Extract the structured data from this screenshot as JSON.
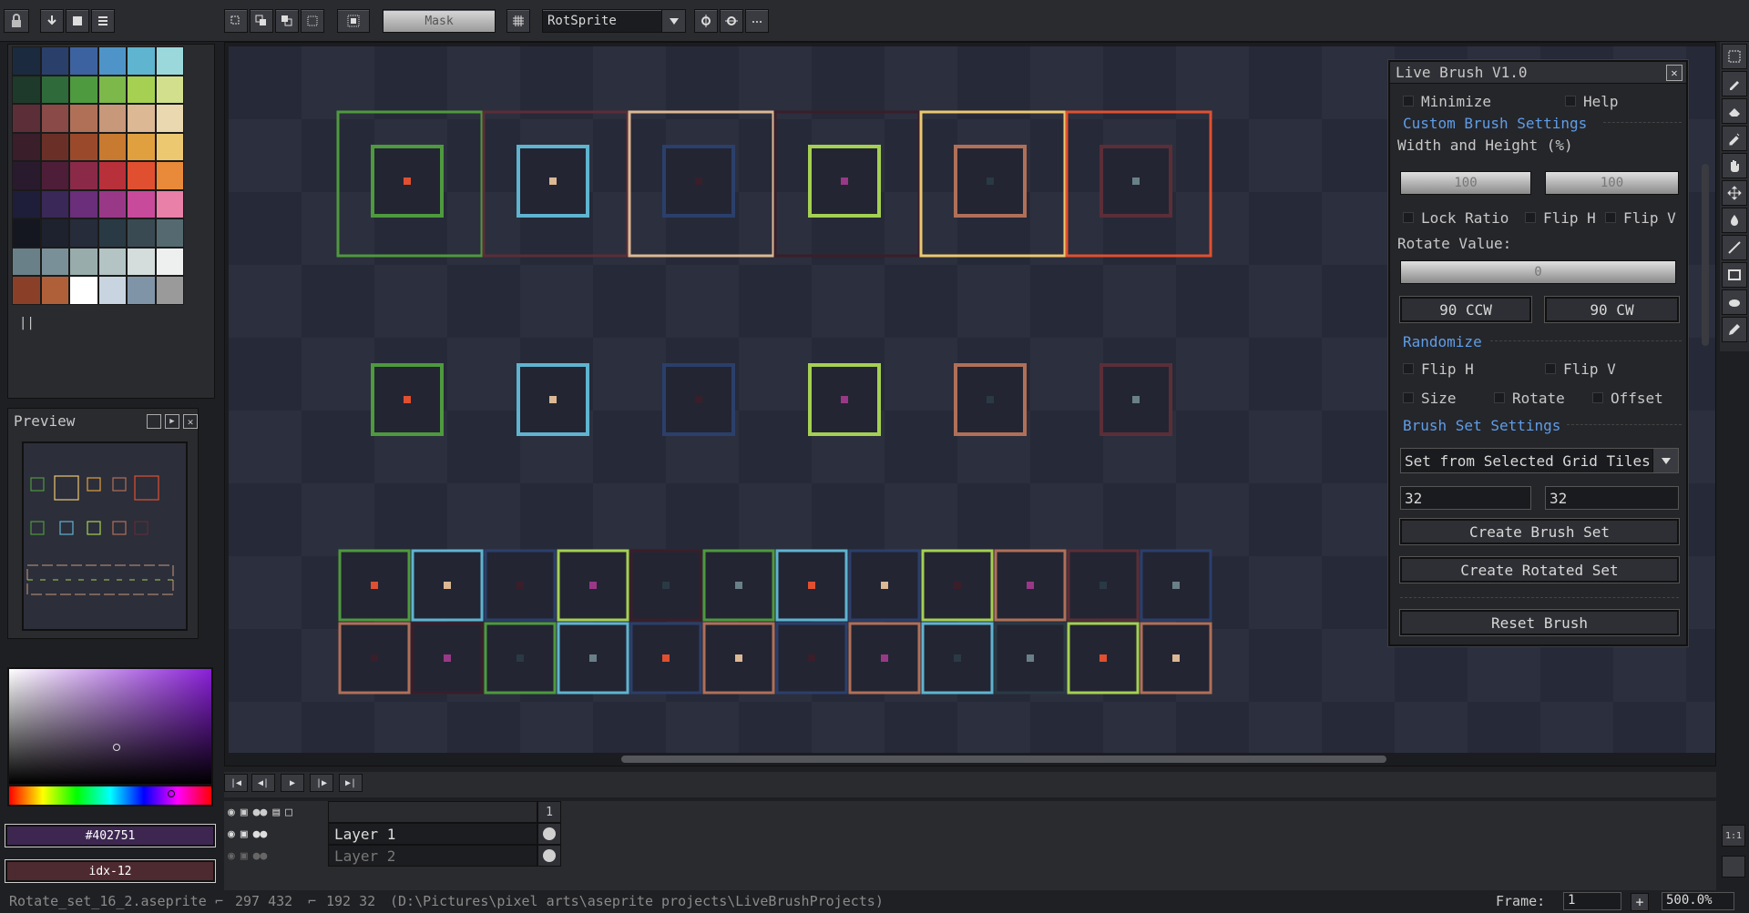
{
  "toolbar": {
    "mask_label": "Mask",
    "rotation_algorithm": "RotSprite"
  },
  "palette": {
    "colors": [
      "#1b2a3e",
      "#2b3f6b",
      "#3d62a0",
      "#4f94c8",
      "#5fb4d0",
      "#9bd8dc",
      "#1e3a2a",
      "#2f6a3a",
      "#4e9a3e",
      "#7db84a",
      "#a5d052",
      "#d2e08e",
      "#5b2e38",
      "#8a4a48",
      "#b07058",
      "#c8987a",
      "#dcb894",
      "#ead8b0",
      "#3a1e2a",
      "#6a3028",
      "#9a4a2a",
      "#c87a30",
      "#e0a040",
      "#ecc870",
      "#2a1a2e",
      "#4e1e38",
      "#8a2a48",
      "#b8303a",
      "#e05030",
      "#e88a3a",
      "#1e1e3a",
      "#3a2858",
      "#6a2e7a",
      "#9a3888",
      "#c84a9a",
      "#e880a8",
      "#141620",
      "#1e222e",
      "#262c3a",
      "#2a3a44",
      "#3a4a52",
      "#546a70",
      "#6a8088",
      "#7a9098",
      "#98acac",
      "#b4c4c4",
      "#d4dcdc",
      "#eef0f0",
      "#8a4028",
      "#b06038",
      "#ffffff",
      "#c8d4e0",
      "#8094a8",
      "#9a9a9a"
    ],
    "drag_handle": "||"
  },
  "preview": {
    "title": "Preview"
  },
  "color": {
    "hex": "#402751",
    "index": "idx-12",
    "accent": "#402751"
  },
  "dialog": {
    "title": "Live Brush V1.0",
    "minimize": "Minimize",
    "help": "Help",
    "custom_section": "Custom Brush Settings",
    "wh_label": "Width and Height (%)",
    "width": "100",
    "height": "100",
    "lock_ratio": "Lock Ratio",
    "flip_h": "Flip H",
    "flip_v": "Flip V",
    "rotate_label": "Rotate Value:",
    "rotate_value": "0",
    "ccw": "90 CCW",
    "cw": "90 CW",
    "random_section": "Randomize",
    "r_flip_h": "Flip H",
    "r_flip_v": "Flip V",
    "r_size": "Size",
    "r_rotate": "Rotate",
    "r_offset": "Offset",
    "brushset_section": "Brush Set Settings",
    "brushset_mode": "Set from Selected Grid Tiles",
    "grid_w": "32",
    "grid_h": "32",
    "create_set": "Create Brush Set",
    "create_rotated": "Create Rotated Set",
    "reset": "Reset Brush"
  },
  "timeline": {
    "frame_header": "1",
    "layers": [
      {
        "name": "Layer 1",
        "visible": true
      },
      {
        "name": "Layer 2",
        "visible": false
      }
    ]
  },
  "status": {
    "filename": "Rotate_set_16_2.aseprite",
    "position": "297 432",
    "size": "192 32",
    "path": "(D:\\Pictures\\pixel arts\\aseprite projects\\LiveBrushProjects)",
    "frame_label": "Frame:",
    "frame_value": "1",
    "zoom": "500.0%"
  }
}
